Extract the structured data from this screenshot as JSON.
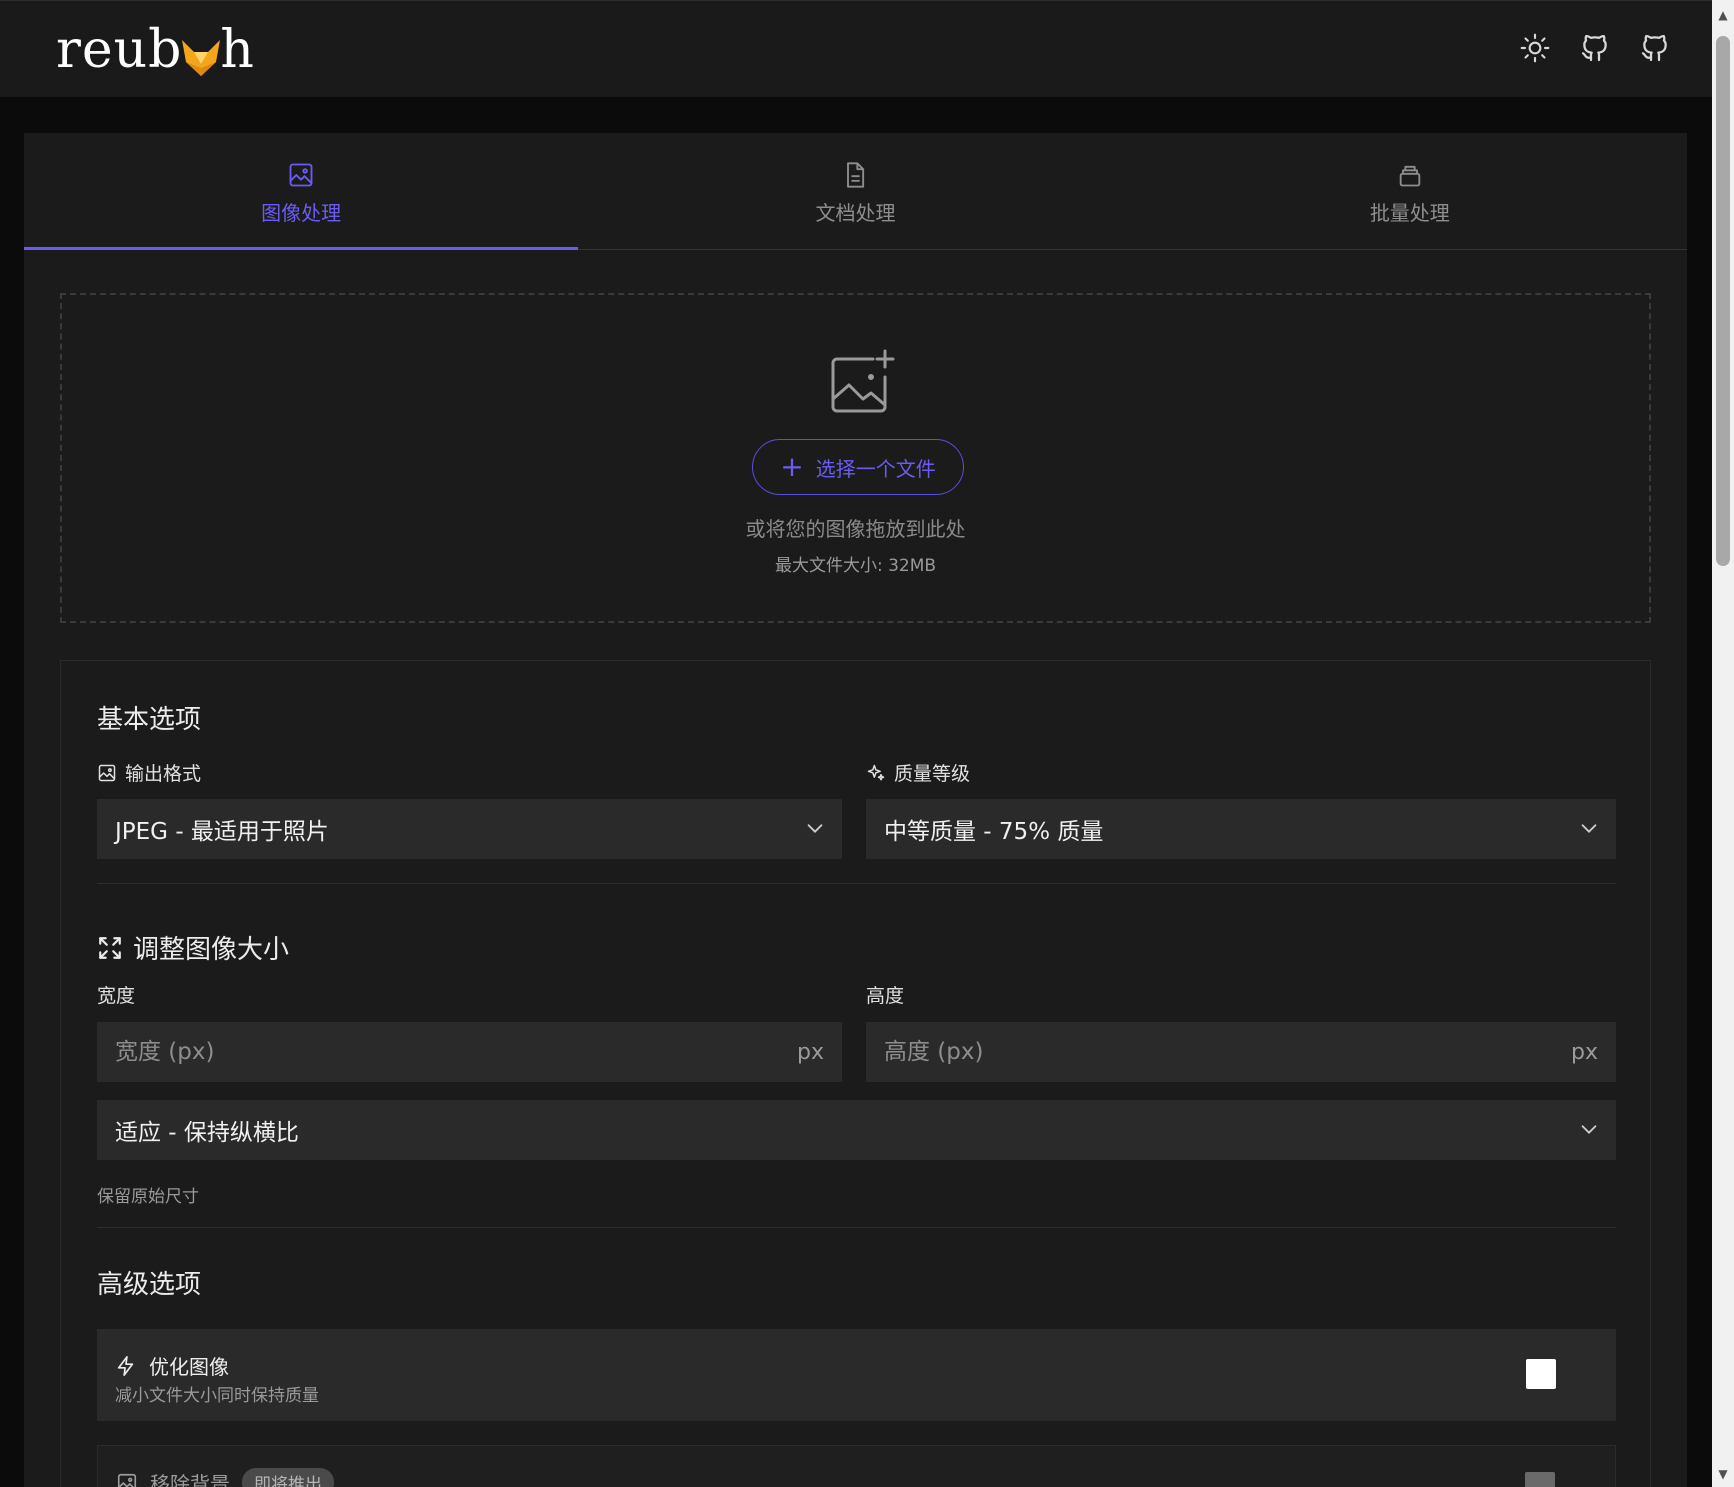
{
  "header": {
    "logo_text_left": "reub",
    "logo_text_right": "h",
    "icons": [
      "sun-icon",
      "github-icon",
      "github-icon"
    ]
  },
  "tabs": [
    {
      "label": "图像处理",
      "icon": "image-icon",
      "active": true
    },
    {
      "label": "文档处理",
      "icon": "document-icon",
      "active": false
    },
    {
      "label": "批量处理",
      "icon": "stack-icon",
      "active": false
    }
  ],
  "upload": {
    "button_label": "选择一个文件",
    "hint": "或将您的图像拖放到此处",
    "limit": "最大文件大小: 32MB"
  },
  "basic": {
    "title": "基本选项",
    "format_label": "输出格式",
    "format_value": "JPEG - 最适用于照片",
    "quality_label": "质量等级",
    "quality_value": "中等质量 - 75% 质量"
  },
  "resize": {
    "title": "调整图像大小",
    "width_label": "宽度",
    "width_placeholder": "宽度 (px)",
    "height_label": "高度",
    "height_placeholder": "高度 (px)",
    "unit": "px",
    "fit_value": "适应 - 保持纵横比",
    "note": "保留原始尺寸"
  },
  "advanced": {
    "title": "高级选项",
    "optimize_title": "优化图像",
    "optimize_desc": "减小文件大小同时保持质量",
    "remove_bg_title": "移除背景",
    "remove_bg_badge": "即将推出"
  },
  "colors": {
    "accent": "#6a5cf0",
    "background": "#0b0b0b",
    "card": "#1b1b1b",
    "field": "#2a2a2a"
  }
}
